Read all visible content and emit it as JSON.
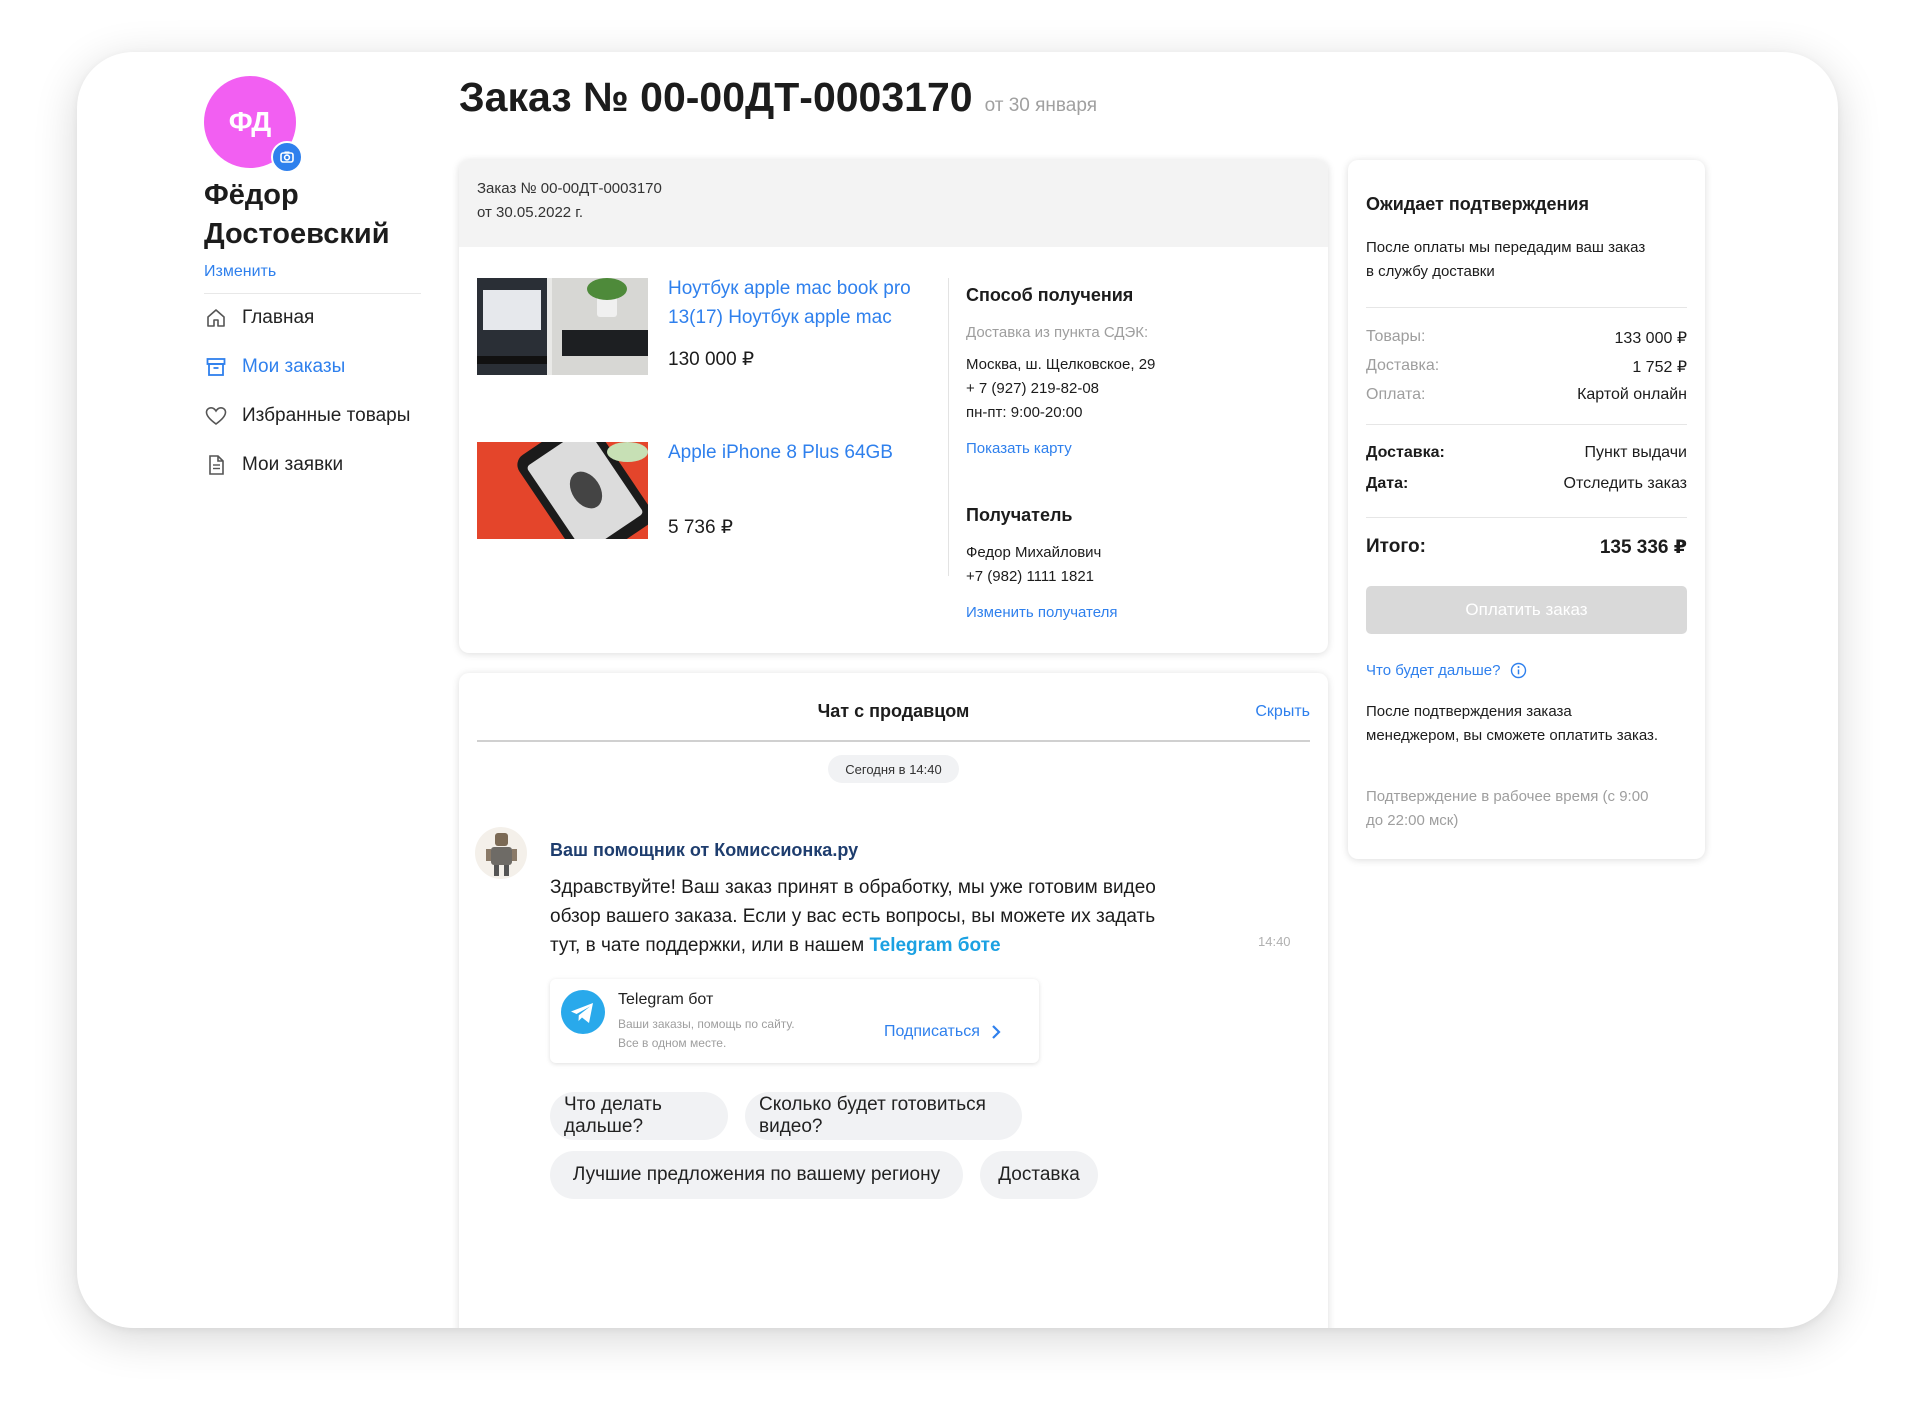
{
  "profile": {
    "initials": "ФД",
    "first_name": "Фёдор",
    "last_name": "Достоевский",
    "edit_label": "Изменить",
    "avatar_color": "#f25ff2"
  },
  "sidebar": {
    "items": [
      {
        "label": "Главная",
        "icon": "home-icon",
        "active": false
      },
      {
        "label": "Мои заказы",
        "icon": "orders-box-icon",
        "active": true
      },
      {
        "label": "Избранные товары",
        "icon": "heart-icon",
        "active": false
      },
      {
        "label": "Мои заявки",
        "icon": "document-icon",
        "active": false
      }
    ]
  },
  "order": {
    "title": "Заказ № 00-00ДТ-0003170",
    "date_caption": "от 30 января",
    "header_line1": "Заказ № 00-00ДТ-0003170",
    "header_line2": "от 30.05.2022 г.",
    "items": [
      {
        "name": "Ноутбук apple mac book pro 13(17) Ноутбук apple mac",
        "price": "130 000 ₽"
      },
      {
        "name": "Apple iPhone 8 Plus 64GB",
        "price": "5 736 ₽"
      }
    ],
    "delivery": {
      "heading": "Способ получения",
      "method": "Доставка из пункта СДЭК:",
      "address": "Москва, ш. Щелковское, 29",
      "phone": "+ 7 (927) 219-82-08",
      "hours": "пн-пт: 9:00-20:00",
      "map_link": "Показать карту"
    },
    "recipient": {
      "heading": "Получатель",
      "name": "Федор Михайлович",
      "phone": "+7 (982) 1111 1821",
      "change_link": "Изменить получателя"
    }
  },
  "summary": {
    "status_title": "Ожидает подтверждения",
    "status_text": "После оплаты мы передадим ваш заказ в службу доставки",
    "goods_label": "Товары:",
    "goods_value": "133 000 ₽",
    "shipping_label": "Доставка:",
    "shipping_value": "1 752 ₽",
    "payment_label": "Оплата:",
    "payment_value": "Картой онлайн",
    "delivery_label": "Доставка:",
    "delivery_value": "Пункт выдачи",
    "date_label": "Дата:",
    "date_value": "Отследить заказ",
    "total_label": "Итого:",
    "total_value": "135 336 ₽",
    "pay_button": "Оплатить заказ",
    "next_link": "Что будет дальше?",
    "info_text": "После подтверждения заказа менеджером, вы сможете оплатить заказ.",
    "hours_text": "Подтверждение в рабочее время (с 9:00 до 22:00 мск)"
  },
  "chat": {
    "title": "Чат с продавцом",
    "hide_label": "Скрыть",
    "date_pill": "Сегодня в 14:40",
    "sender": "Ваш помощник от Комиссионка.ру",
    "message": "Здравствуйте! Ваш заказ принят в обработку, мы уже готовим видео обзор вашего заказа. Если у вас есть вопросы, вы можете их задать тут, в чате поддержки, или в нашем",
    "message_link": "Telegram боте",
    "time": "14:40",
    "telegram_card": {
      "title": "Telegram бот",
      "line1": "Ваши заказы, помощь по сайту.",
      "line2": "Все в одном месте.",
      "subscribe": "Подписаться"
    },
    "quick_replies": [
      "Что делать дальше?",
      "Сколько будет готовиться видео?",
      "Лучшие предложения по вашему региону",
      "Доставка"
    ]
  },
  "colors": {
    "accent": "#2f80ed",
    "telegram": "#29a9eb",
    "button_disabled": "#d9d9d9",
    "message_link": "#1ba1e2"
  }
}
